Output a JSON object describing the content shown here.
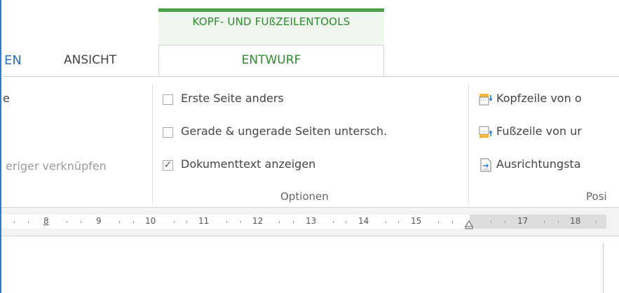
{
  "tabs": {
    "partial_left": "EN",
    "ansicht": "ANSICHT",
    "context_group": "KOPF- UND FUßZEILENTOOLS",
    "entwurf": "ENTWURF"
  },
  "navigation": {
    "partial_top": "e",
    "link_previous": "eriger verknüpfen"
  },
  "options": {
    "items": [
      {
        "label": "Erste Seite anders",
        "checked": false
      },
      {
        "label": "Gerade & ungerade Seiten untersch.",
        "checked": false
      },
      {
        "label": "Dokumenttext anzeigen",
        "checked": true
      }
    ],
    "group_label": "Optionen",
    "check_glyph": "✓"
  },
  "position": {
    "items": [
      {
        "label": "Kopfzeile von o",
        "icon": "header-top-icon"
      },
      {
        "label": "Fußzeile von ur",
        "icon": "footer-bottom-icon"
      },
      {
        "label": "Ausrichtungsta",
        "icon": "alignment-tab-icon"
      }
    ],
    "group_label": "Posi"
  },
  "ruler": {
    "labels": [
      "8",
      "9",
      "10",
      "11",
      "12",
      "13",
      "14",
      "15",
      "17",
      "18"
    ]
  },
  "colors": {
    "context_green": "#4aa14a",
    "accent_blue": "#2b7cd3"
  }
}
